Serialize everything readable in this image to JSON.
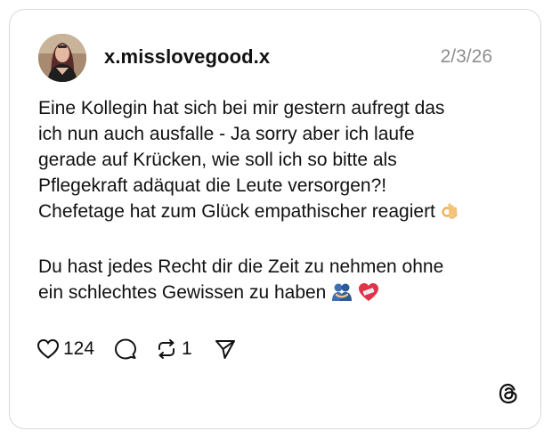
{
  "post": {
    "username": "x.misslovegood.x",
    "date": "2/3/26",
    "lines_p1": [
      "Eine Kollegin hat sich bei mir gestern aufregt das",
      "ich nun auch ausfalle - Ja sorry aber ich laufe",
      "gerade auf Krücken, wie soll ich so bitte als",
      "Pflegekraft adäquat die Leute versorgen?!",
      "Chefetage hat zum Glück empathischer reagiert"
    ],
    "lines_p2": [
      "Du hast jedes Recht dir die Zeit zu nehmen ohne",
      "ein schlechtes Gewissen zu haben"
    ],
    "emojis": [
      "ok-hand-emoji",
      "people-hugging-emoji",
      "mending-heart-emoji"
    ]
  },
  "actions": {
    "likes": "124",
    "reposts": "1"
  },
  "icons": {
    "like": "heart-icon",
    "comment": "comment-icon",
    "repost": "repost-icon",
    "share": "send-icon",
    "brand": "threads-logo-icon"
  },
  "colors": {
    "text": "#111111",
    "muted": "#8e8e8e",
    "border": "#d9d9d9"
  }
}
